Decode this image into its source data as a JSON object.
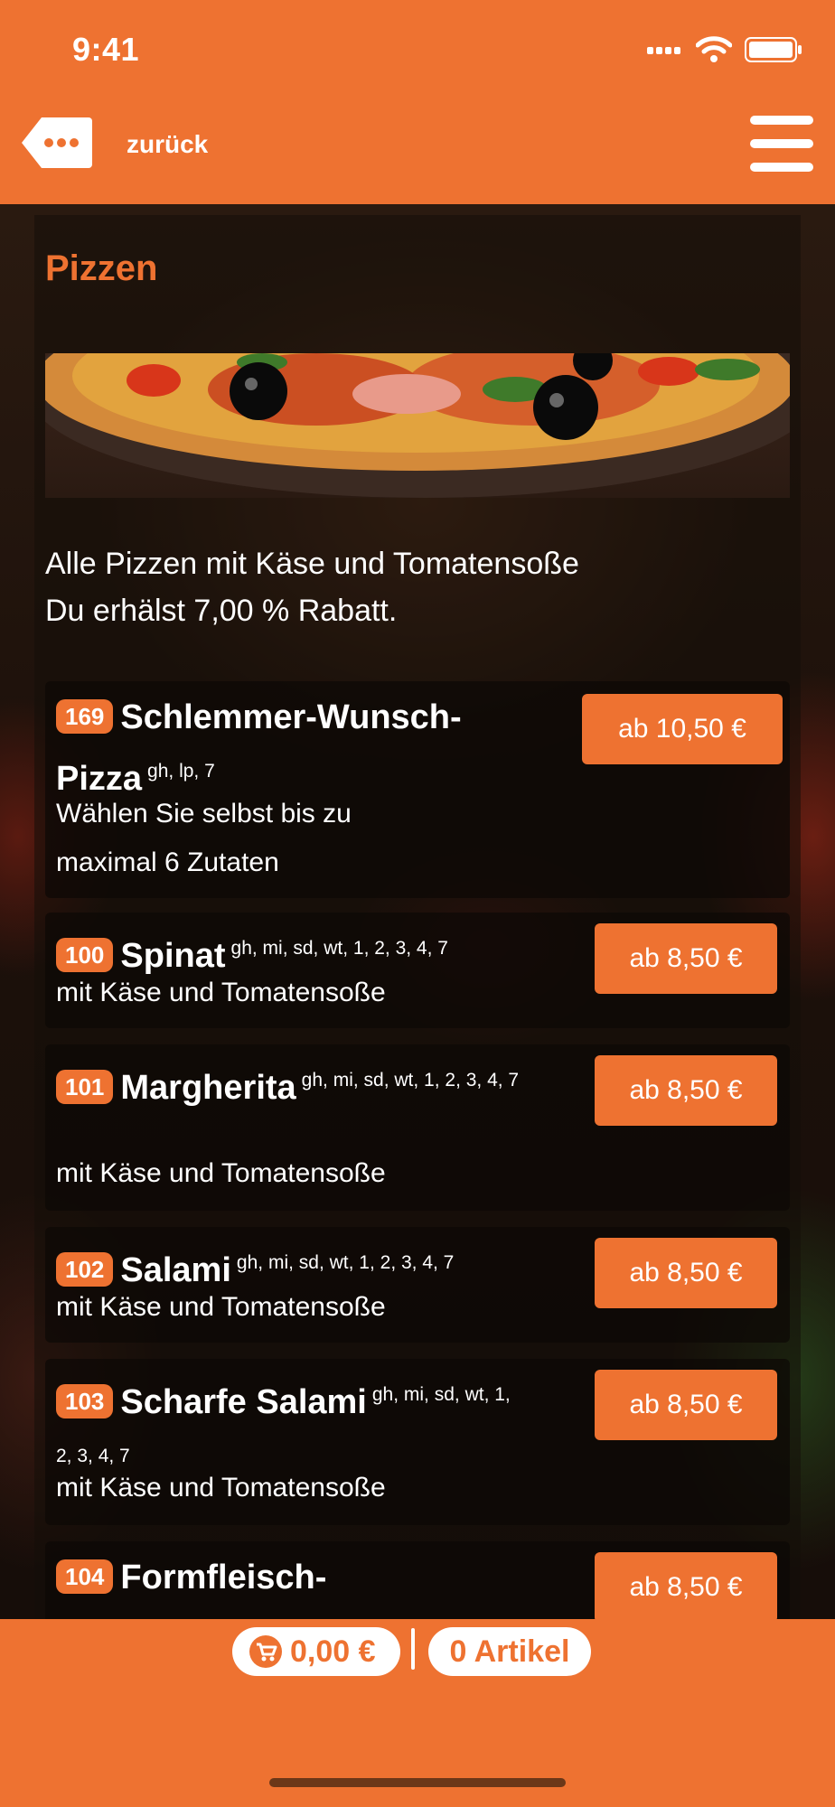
{
  "status": {
    "time": "9:41"
  },
  "header": {
    "back_label": "zurück"
  },
  "category": {
    "title": "Pizzen",
    "intro_line1": "Alle Pizzen mit Käse und Tomatensoße",
    "intro_line2": "Du erhälst 7,00 % Rabatt."
  },
  "products": [
    {
      "number": "169",
      "name": "Schlemmer-Wunsch-Pizza",
      "allergens": "gh, lp, 7",
      "description": "Wählen Sie selbst bis zu maximal 6 Zutaten",
      "price": "ab 10,50 €"
    },
    {
      "number": "100",
      "name": "Spinat",
      "allergens": "gh, mi, sd, wt, 1, 2, 3, 4, 7",
      "description": "mit Käse und Tomatensoße",
      "price": "ab 8,50 €"
    },
    {
      "number": "101",
      "name": "Margherita",
      "allergens": "gh, mi, sd, wt, 1, 2, 3, 4, 7",
      "description": "mit Käse und Tomatensoße",
      "price": "ab 8,50 €"
    },
    {
      "number": "102",
      "name": "Salami",
      "allergens": "gh, mi, sd, wt, 1, 2, 3, 4, 7",
      "description": "mit Käse und Tomatensoße",
      "price": "ab 8,50 €"
    },
    {
      "number": "103",
      "name": "Scharfe Salami",
      "allergens": "gh, mi, sd, wt, 1, 2, 3, 4, 7",
      "description": "mit Käse und Tomatensoße",
      "price": "ab 8,50 €"
    },
    {
      "number": "104",
      "name": "Formfleisch-",
      "allergens": "",
      "description": "",
      "price": "ab 8,50 €"
    }
  ],
  "cart": {
    "total": "0,00 €",
    "items": "0 Artikel"
  },
  "icons": {
    "back": "dots-back-icon",
    "menu": "hamburger-menu-icon",
    "cart": "cart-icon"
  },
  "colors": {
    "accent": "#ee7231"
  }
}
